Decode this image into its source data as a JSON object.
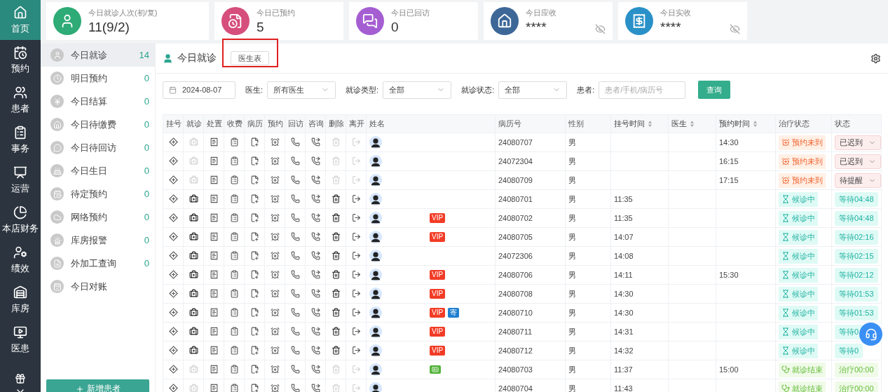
{
  "nav": [
    {
      "label": "首页",
      "selected": true
    },
    {
      "label": "预约",
      "selected": false
    },
    {
      "label": "患者",
      "selected": false
    },
    {
      "label": "事务",
      "selected": false
    },
    {
      "label": "运营",
      "selected": false
    },
    {
      "label": "本店财务",
      "selected": false
    },
    {
      "label": "绩效",
      "selected": false
    },
    {
      "label": "库房",
      "selected": false
    },
    {
      "label": "医患",
      "selected": false
    }
  ],
  "stats": [
    {
      "label": "今日就诊人次(初/复)",
      "value": "11(9/2)",
      "masked": false
    },
    {
      "label": "今日已预约",
      "value": "5",
      "masked": false
    },
    {
      "label": "今日已回访",
      "value": "0",
      "masked": false
    },
    {
      "label": "今日应收",
      "value": "****",
      "masked": true
    },
    {
      "label": "今日实收",
      "value": "****",
      "masked": true
    }
  ],
  "sidebar": {
    "items": [
      {
        "label": "今日就诊",
        "count": "14",
        "selected": true
      },
      {
        "label": "明日预约",
        "count": "0",
        "selected": false
      },
      {
        "label": "今日结算",
        "count": "0",
        "selected": false
      },
      {
        "label": "今日待缴费",
        "count": "0",
        "selected": false
      },
      {
        "label": "今日待回访",
        "count": "0",
        "selected": false
      },
      {
        "label": "今日生日",
        "count": "0",
        "selected": false
      },
      {
        "label": "待定预约",
        "count": "0",
        "selected": false
      },
      {
        "label": "网络预约",
        "count": "0",
        "selected": false
      },
      {
        "label": "库房报警",
        "count": "0",
        "selected": false
      },
      {
        "label": "外加工查询",
        "count": "0",
        "selected": false
      },
      {
        "label": "今日对账",
        "selected": false
      }
    ],
    "add_button": "新增患者"
  },
  "panel": {
    "title": "今日就诊",
    "doctor_table_button": "医生表",
    "filters": {
      "date": "2024-08-07",
      "doctor_label": "医生:",
      "doctor_value": "所有医生",
      "type_label": "就诊类型:",
      "type_value": "全部",
      "status_label": "就诊状态:",
      "status_value": "全部",
      "patient_label": "患者:",
      "patient_placeholder": "患者/手机/病历号"
    },
    "search_button": "查询"
  },
  "table": {
    "columns": [
      {
        "label": "挂号",
        "kind": "action",
        "sortable": false
      },
      {
        "label": "就诊",
        "kind": "action",
        "sortable": false
      },
      {
        "label": "处置",
        "kind": "action",
        "sortable": false
      },
      {
        "label": "收费",
        "kind": "action",
        "sortable": false
      },
      {
        "label": "病历",
        "kind": "action",
        "sortable": false
      },
      {
        "label": "预约",
        "kind": "action",
        "sortable": false
      },
      {
        "label": "回访",
        "kind": "action",
        "sortable": false
      },
      {
        "label": "咨询",
        "kind": "action",
        "sortable": false
      },
      {
        "label": "删除",
        "kind": "action",
        "sortable": false
      },
      {
        "label": "离开",
        "kind": "action",
        "sortable": false
      },
      {
        "label": "姓名",
        "kind": "data",
        "sortable": false
      },
      {
        "label": "病历号",
        "kind": "data",
        "sortable": false
      },
      {
        "label": "性别",
        "kind": "data",
        "sortable": false
      },
      {
        "label": "挂号时间",
        "kind": "data",
        "sortable": true
      },
      {
        "label": "医生",
        "kind": "data",
        "sortable": true
      },
      {
        "label": "预约时间",
        "kind": "data",
        "sortable": true
      },
      {
        "label": "治疗状态",
        "kind": "data",
        "sortable": false
      },
      {
        "label": "状态",
        "kind": "data",
        "sortable": false
      }
    ],
    "rows": [
      {
        "record_no": "24080707",
        "gender": "男",
        "appt_time": "14:30",
        "actions_enabled": false,
        "tags": [],
        "treatment": {
          "kind": "missed",
          "text": "预约未到"
        },
        "status": {
          "kind": "select",
          "text": "已迟到"
        }
      },
      {
        "record_no": "24072304",
        "gender": "男",
        "appt_time": "16:15",
        "actions_enabled": false,
        "tags": [],
        "treatment": {
          "kind": "missed",
          "text": "预约未到"
        },
        "status": {
          "kind": "select",
          "text": "已迟到"
        }
      },
      {
        "record_no": "24080709",
        "gender": "男",
        "appt_time": "17:15",
        "actions_enabled": false,
        "tags": [],
        "treatment": {
          "kind": "missed",
          "text": "预约未到"
        },
        "status": {
          "kind": "select",
          "text": "待提醒"
        }
      },
      {
        "record_no": "24080701",
        "gender": "男",
        "reg_time": "11:35",
        "actions_enabled": true,
        "tags": [],
        "treatment": {
          "kind": "waiting",
          "text": "候诊中"
        },
        "status": {
          "kind": "waiting",
          "text": "等待04:48"
        }
      },
      {
        "record_no": "24080702",
        "gender": "男",
        "reg_time": "11:35",
        "actions_enabled": true,
        "tags": [
          {
            "kind": "vip",
            "text": "VIP"
          }
        ],
        "treatment": {
          "kind": "waiting",
          "text": "候诊中"
        },
        "status": {
          "kind": "waiting",
          "text": "等待04:48"
        }
      },
      {
        "record_no": "24080705",
        "gender": "男",
        "reg_time": "14:07",
        "actions_enabled": true,
        "tags": [
          {
            "kind": "vip",
            "text": "VIP"
          }
        ],
        "treatment": {
          "kind": "waiting",
          "text": "候诊中"
        },
        "status": {
          "kind": "waiting",
          "text": "等待02:16"
        }
      },
      {
        "record_no": "24072306",
        "gender": "男",
        "reg_time": "14:08",
        "actions_enabled": true,
        "tags": [],
        "treatment": {
          "kind": "waiting",
          "text": "候诊中"
        },
        "status": {
          "kind": "waiting",
          "text": "等待02:15"
        }
      },
      {
        "record_no": "24080706",
        "gender": "男",
        "reg_time": "14:11",
        "appt_time": "15:30",
        "actions_enabled": true,
        "tags": [
          {
            "kind": "vip",
            "text": "VIP"
          }
        ],
        "treatment": {
          "kind": "waiting",
          "text": "候诊中"
        },
        "status": {
          "kind": "waiting",
          "text": "等待02:12"
        }
      },
      {
        "record_no": "24080708",
        "gender": "男",
        "reg_time": "14:30",
        "actions_enabled": true,
        "tags": [
          {
            "kind": "vip",
            "text": "VIP"
          }
        ],
        "treatment": {
          "kind": "waiting",
          "text": "候诊中"
        },
        "status": {
          "kind": "waiting",
          "text": "等待01:53"
        }
      },
      {
        "record_no": "24080710",
        "gender": "男",
        "reg_time": "14:30",
        "actions_enabled": true,
        "tags": [
          {
            "kind": "vip",
            "text": "VIP"
          },
          {
            "kind": "mail",
            "text": "寄"
          }
        ],
        "treatment": {
          "kind": "waiting",
          "text": "候诊中"
        },
        "status": {
          "kind": "waiting",
          "text": "等待01:53"
        }
      },
      {
        "record_no": "24080711",
        "gender": "男",
        "reg_time": "14:31",
        "actions_enabled": true,
        "tags": [
          {
            "kind": "vip",
            "text": "VIP"
          }
        ],
        "treatment": {
          "kind": "waiting",
          "text": "候诊中"
        },
        "status": {
          "kind": "waiting",
          "text": "等待0"
        }
      },
      {
        "record_no": "24080712",
        "gender": "男",
        "reg_time": "14:32",
        "actions_enabled": true,
        "tags": [
          {
            "kind": "vip",
            "text": "VIP"
          }
        ],
        "treatment": {
          "kind": "waiting",
          "text": "候诊中"
        },
        "status": {
          "kind": "waiting",
          "text": "等待0"
        }
      },
      {
        "record_no": "24080703",
        "gender": "男",
        "reg_time": "11:37",
        "appt_time": "15:00",
        "actions_enabled": false,
        "tags": [
          {
            "kind": "card"
          }
        ],
        "treatment": {
          "kind": "done",
          "text": "就诊结束"
        },
        "status": {
          "kind": "treating",
          "text": "治疗00:00"
        }
      },
      {
        "record_no": "24080704",
        "gender": "男",
        "reg_time": "11:43",
        "actions_enabled": false,
        "tags": [],
        "treatment": {
          "kind": "done",
          "text": "就诊结束"
        },
        "status": {
          "kind": "treating",
          "text": "治疗00:00"
        }
      }
    ]
  }
}
